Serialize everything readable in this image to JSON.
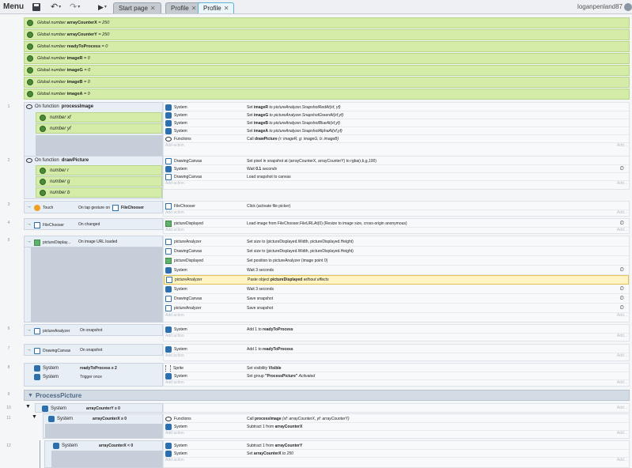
{
  "toolbar": {
    "menu_label": "Menu",
    "undo_icon": "undo-icon",
    "redo_icon": "redo-icon",
    "play_icon": "play-icon",
    "tabs": [
      {
        "label": "Start page",
        "active": false
      },
      {
        "label": "Profile",
        "active": false
      },
      {
        "label": "Profile",
        "active": true
      }
    ],
    "user": "loganpenland87"
  },
  "globals": [
    {
      "prefix": "Global number",
      "name": "arrayCounterX",
      "value": "= 250"
    },
    {
      "prefix": "Global number",
      "name": "arrayCounterY",
      "value": "= 250"
    },
    {
      "prefix": "Global number",
      "name": "readyToProcess",
      "value": "= 0"
    },
    {
      "prefix": "Global number",
      "name": "imageR",
      "value": "= 0"
    },
    {
      "prefix": "Global number",
      "name": "imageG",
      "value": "= 0"
    },
    {
      "prefix": "Global number",
      "name": "imageB",
      "value": "= 0"
    },
    {
      "prefix": "Global number",
      "name": "imageA",
      "value": "= 0"
    }
  ],
  "add_action": "Add action",
  "add_short": "Add...",
  "events": {
    "e1": {
      "num": "1",
      "title_pre": "On function",
      "title": "processImage",
      "params": [
        "number xf",
        "number yf"
      ],
      "actions": [
        {
          "obj": "System",
          "pre": "Set",
          "bold": "imageR",
          "post": "to pictureAnalyzer.SnapshotRedAt(xf, yf)"
        },
        {
          "obj": "System",
          "pre": "Set",
          "bold": "imageG",
          "post": "to pictureAnalyzer.SnapshotGreenAt(xf,yf)"
        },
        {
          "obj": "System",
          "pre": "Set",
          "bold": "imageB",
          "post": "to pictureAnalyzer.SnapshotBlueAt(xf,yf)"
        },
        {
          "obj": "System",
          "pre": "Set",
          "bold": "imageA",
          "post": "to pictureAnalyzer.SnapshotAlphaAt(xf,yf)"
        },
        {
          "obj": "Functions",
          "pre": "Call",
          "bold": "drawPicture",
          "post": "(r: imageR, g: imageG, b: imageB)"
        }
      ]
    },
    "e2": {
      "num": "2",
      "title_pre": "On function",
      "title": "drawPicture",
      "params": [
        "number r",
        "number g",
        "number b"
      ],
      "actions": [
        {
          "obj": "DrawingCanvas",
          "text": "Set pixel in snapshot at (arrayCounterX, arrayCounterY) to rgba(r,b,g,100)"
        },
        {
          "obj": "System",
          "pre": "Wait",
          "bold": "0.1",
          "post": "seconds"
        },
        {
          "obj": "DrawingCanvas",
          "text": "Load snapshot to canvas"
        }
      ]
    },
    "e3": {
      "num": "3",
      "obj": "Touch",
      "cond_pre": "On tap gesture on",
      "cond_obj": "FileChooser",
      "actions": [
        {
          "obj": "FileChooser",
          "text": "Click (activate file picker)"
        }
      ]
    },
    "e4": {
      "num": "4",
      "obj": "FileChooser",
      "cond": "On changed",
      "actions": [
        {
          "obj": "pictureDisplayed",
          "text": "Load image from FileChooser.FileURLAt(0) (Resize to image size, cross-origin anonymous)"
        }
      ]
    },
    "e5": {
      "num": "5",
      "obj": "pictureDisplay...",
      "cond": "On image URL loaded",
      "actions": [
        {
          "obj": "pictureAnalyzer",
          "text": "Set size to (pictureDisplayed.Width, pictureDisplayed.Height)"
        },
        {
          "obj": "DrawingCanvas",
          "text": "Set size to (pictureDisplayed.Width, pictureDisplayed.Height)"
        },
        {
          "obj": "pictureDisplayed",
          "text": "Set position to pictureAnalyzer (image point 0)"
        },
        {
          "obj": "System",
          "text": "Wait 3 seconds"
        },
        {
          "obj": "pictureAnalyzer",
          "pre": "Paste object",
          "bold": "pictureDisplayed",
          "post": "without effects"
        },
        {
          "obj": "System",
          "text": "Wait 3 seconds"
        },
        {
          "obj": "DrawingCanvas",
          "text": "Save snapshot"
        },
        {
          "obj": "pictureAnalyzer",
          "text": "Save snapshot"
        }
      ]
    },
    "e6": {
      "num": "6",
      "obj": "pictureAnalyzer",
      "cond": "On snapshot",
      "actions": [
        {
          "obj": "System",
          "pre": "Add 1 to",
          "bold": "readyToProcess",
          "post": ""
        }
      ]
    },
    "e7": {
      "num": "7",
      "obj": "DrawingCanvas",
      "cond": "On snapshot",
      "actions": [
        {
          "obj": "System",
          "pre": "Add 1 to",
          "bold": "readyToProcess",
          "post": ""
        }
      ]
    },
    "e8": {
      "num": "8",
      "conds": [
        {
          "obj": "System",
          "text": "readyToProcess ≥ 2"
        },
        {
          "obj": "System",
          "text": "Trigger once"
        }
      ],
      "actions": [
        {
          "obj": "Sprite",
          "pre": "Set visibility",
          "bold": "Visible",
          "post": ""
        },
        {
          "obj": "System",
          "pre": "Set group",
          "bold": "\"ProcessPicture\"",
          "post": "Activated"
        }
      ]
    },
    "group": {
      "num": "9",
      "title": "ProcessPicture"
    },
    "e10": {
      "num": "10",
      "obj": "System",
      "cond": "arrayCounterY ≥ 0"
    },
    "e11": {
      "num": "11",
      "obj": "System",
      "cond": "arrayCounterX ≥ 0",
      "actions": [
        {
          "obj": "Functions",
          "pre": "Call",
          "bold": "processImage",
          "post": "(xf: arrayCounterX, yf: arrayCounterY)"
        },
        {
          "obj": "System",
          "pre": "Subtract 1 from",
          "bold": "arrayCounterX",
          "post": ""
        }
      ]
    },
    "e12": {
      "num": "12",
      "obj": "System",
      "cond": "arrayCounterX < 0",
      "actions": [
        {
          "obj": "System",
          "pre": "Subtract 1 from",
          "bold": "arrayCounterY",
          "post": ""
        },
        {
          "obj": "System",
          "pre": "Set",
          "bold": "arrayCounterX",
          "post": "to 250"
        }
      ]
    }
  }
}
